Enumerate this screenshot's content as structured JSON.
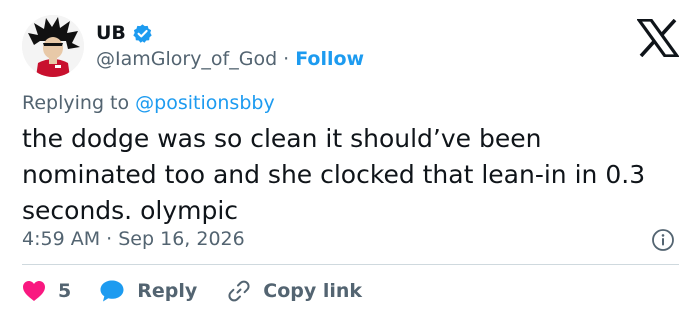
{
  "author": {
    "display_name": "UB",
    "handle": "@IamGlory_of_God",
    "separator": "·",
    "follow_label": "Follow",
    "avatar_icon": "anime-character-avatar",
    "verified_icon": "verified-badge-icon"
  },
  "replying_to": {
    "prefix": "Replying to",
    "mention": "@positionsbby"
  },
  "tweet": {
    "text": "the dodge was so clean it should’ve been nominated too and she clocked that lean-in in 0.3 seconds. olympic",
    "time": "4:59 AM",
    "separator": "·",
    "date": "Sep 16, 2026"
  },
  "actions": {
    "like_count": "5",
    "reply_label": "Reply",
    "copy_label": "Copy link"
  },
  "colors": {
    "accent": "#1d9bf0",
    "like": "#f91880",
    "text": "#0f1419",
    "muted": "#536471",
    "divider": "#cfd9de"
  }
}
